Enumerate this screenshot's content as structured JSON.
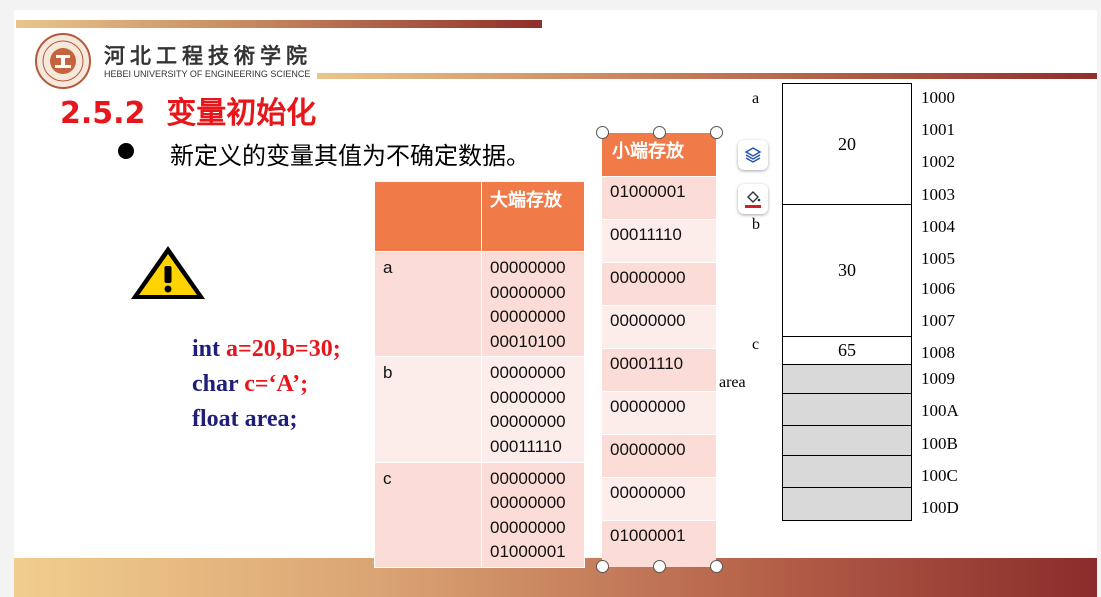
{
  "university": {
    "name_cn": "河北工程技術学院",
    "name_en": "HEBEI UNIVERSITY OF ENGINEERING SCIENCE"
  },
  "section": {
    "number": "2.5.2",
    "title": "变量初始化"
  },
  "bullet": "新定义的变量其值为不确定数据。",
  "code": {
    "line1_kw": "int ",
    "line1_rest": "a=20,b=30;",
    "line2_kw": "char ",
    "line2_rest": "c=‘A’;",
    "line3": "float area;"
  },
  "big_endian": {
    "header": "大端存放",
    "rows": [
      {
        "name": "a",
        "bytes": [
          "00000000",
          "00000000",
          "00000000",
          "00010100"
        ]
      },
      {
        "name": "b",
        "bytes": [
          "00000000",
          "00000000",
          "00000000",
          "00011110"
        ]
      },
      {
        "name": "c",
        "bytes": [
          "00000000",
          "00000000",
          "00000000",
          "01000001"
        ]
      }
    ]
  },
  "little_endian": {
    "header": "小端存放",
    "cells": [
      "01000001",
      "00011110",
      "00000000",
      "00000000",
      "00001110",
      "00000000",
      "00000000",
      "00000000",
      "01000001"
    ]
  },
  "memory": {
    "variables": {
      "a": "a",
      "b": "b",
      "c": "c",
      "area": "area"
    },
    "values": {
      "a": "20",
      "b": "30",
      "c": "65"
    },
    "addresses": [
      "1000",
      "1001",
      "1002",
      "1003",
      "1004",
      "1005",
      "1006",
      "1007",
      "1008",
      "1009",
      "100A",
      "100B",
      "100C",
      "100D"
    ]
  },
  "icons": {
    "warning": "warning-icon",
    "layers": "layers-icon",
    "paint": "paint-bucket-icon"
  },
  "colors": {
    "title_red": "#e8161b",
    "table_orange": "#f07a48",
    "code_blue": "#1f1f7a",
    "row_pink": "#fbdcd6"
  }
}
